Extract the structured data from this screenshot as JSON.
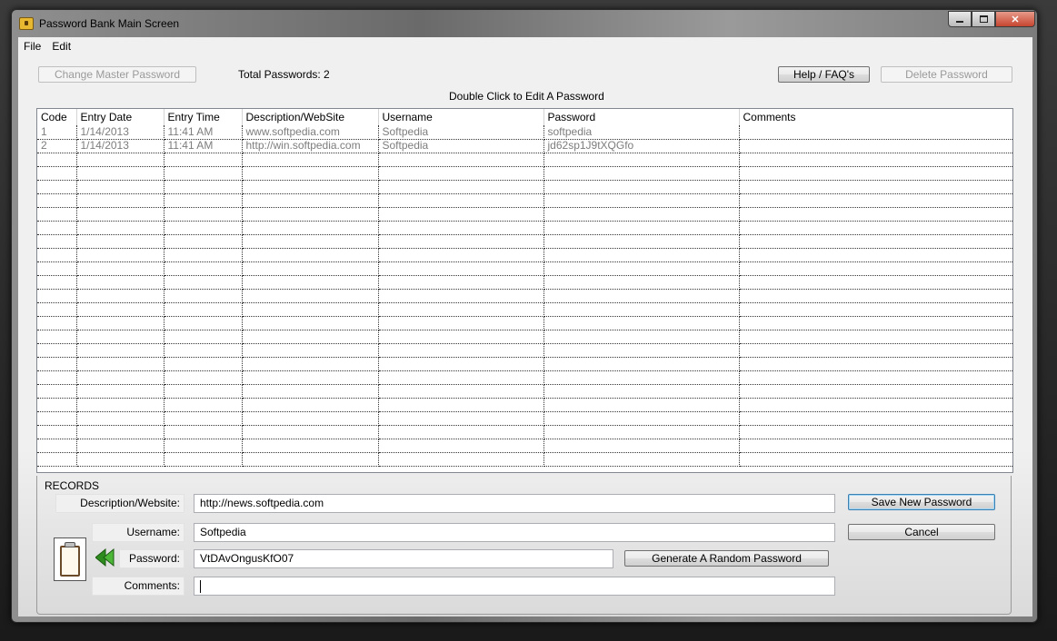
{
  "window": {
    "title": "Password Bank Main Screen"
  },
  "menu": [
    "File",
    "Edit"
  ],
  "toolbar": {
    "change_master_label": "Change Master Password",
    "total_label": "Total Passwords:",
    "total_value": "2",
    "hint": "Double Click to Edit A Password",
    "help_label": "Help / FAQ's",
    "delete_label": "Delete Password"
  },
  "grid": {
    "columns": [
      "Code",
      "Entry Date",
      "Entry Time",
      "Description/WebSite",
      "Username",
      "Password",
      "Comments"
    ],
    "rows": [
      [
        "1",
        "1/14/2013",
        "11:41 AM",
        "www.softpedia.com",
        "Softpedia",
        "softpedia",
        ""
      ],
      [
        "2",
        "1/14/2013",
        "11:41 AM",
        "http://win.softpedia.com",
        "Softpedia",
        "jd62sp1J9tXQGfo",
        ""
      ]
    ],
    "empty_rows": 23
  },
  "records": {
    "title": "RECORDS",
    "description_label": "Description/Website:",
    "description_value": "http://news.softpedia.com",
    "username_label": "Username:",
    "username_value": "Softpedia",
    "password_label": "Password:",
    "password_value": "VtDAvOngusKfO07",
    "comments_label": "Comments:",
    "comments_value": "",
    "save_label": "Save New Password",
    "cancel_label": "Cancel",
    "generate_label": "Generate A Random Password"
  },
  "icons": {
    "app": "lock-icon",
    "clipboard": "clipboard-icon",
    "arrow": "green-back-arrow-icon"
  }
}
